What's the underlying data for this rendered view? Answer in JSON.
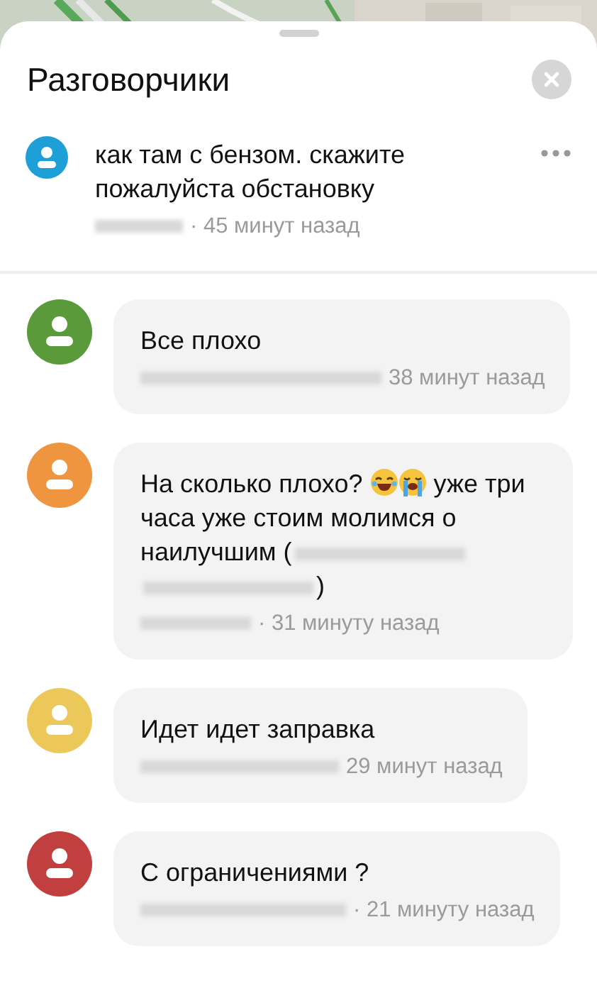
{
  "title": "Разговорчики",
  "post": {
    "color": "#1e9fd8",
    "text": "как там с бензом. скажите пожалуйста обстановку",
    "author_hidden": true,
    "time": "· 45 минут назад"
  },
  "replies": [
    {
      "color": "#5a9a3b",
      "parts": [
        {
          "kind": "text",
          "text": "Все плохо"
        }
      ],
      "author_hidden": true,
      "time": "38 минут назад"
    },
    {
      "color": "#ef9540",
      "parts": [
        {
          "kind": "text",
          "text": "На сколько плохо? "
        },
        {
          "kind": "laughing"
        },
        {
          "kind": "crying"
        },
        {
          "kind": "text",
          "text": " уже три часа уже стоим молимся о наилучшим ("
        },
        {
          "kind": "hidden"
        },
        {
          "kind": "hidden"
        },
        {
          "kind": "text",
          "text": ")"
        }
      ],
      "author_hidden": true,
      "time": "· 31 минуту назад"
    },
    {
      "color": "#ecc85b",
      "parts": [
        {
          "kind": "text",
          "text": "Идет идет заправка"
        }
      ],
      "author_hidden": true,
      "time": "29 минут назад"
    },
    {
      "color": "#c23f3f",
      "parts": [
        {
          "kind": "text",
          "text": "С ограничениями ?"
        }
      ],
      "author_hidden": true,
      "time": "· 21 минуту назад"
    }
  ]
}
